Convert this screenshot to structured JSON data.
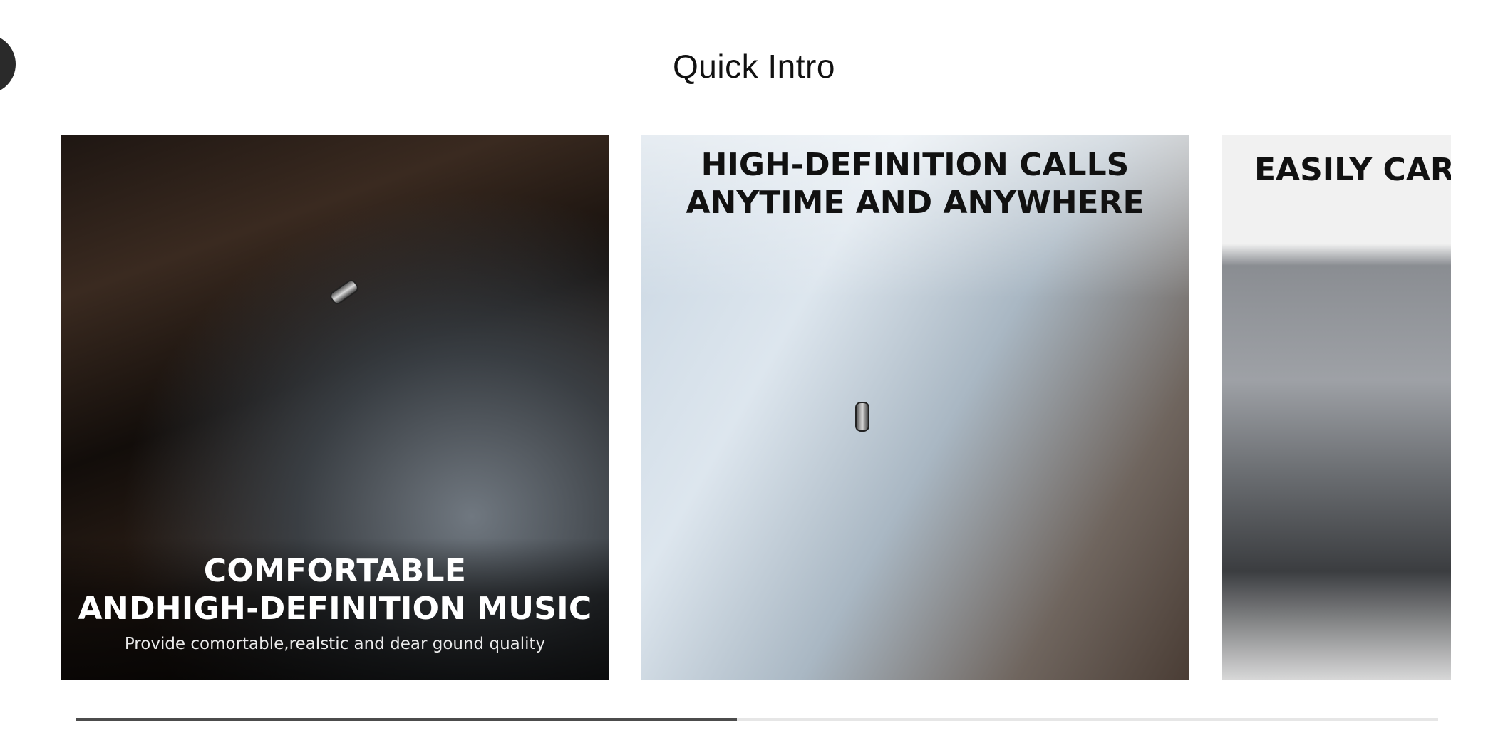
{
  "section": {
    "title": "Quick Intro"
  },
  "cards": [
    {
      "heading_line1": "COMFORTABLE",
      "heading_line2": "ANDHIGH-DEFINITION MUSIC",
      "subtitle": "Provide comortable,realstic and dear gound quality"
    },
    {
      "heading_line1": "HIGH-DEFINITION CALLS",
      "heading_line2": "ANYTIME AND ANYWHERE"
    },
    {
      "heading_line1": "EASILY CAR"
    }
  ],
  "carousel": {
    "progress_fraction": 0.485
  }
}
